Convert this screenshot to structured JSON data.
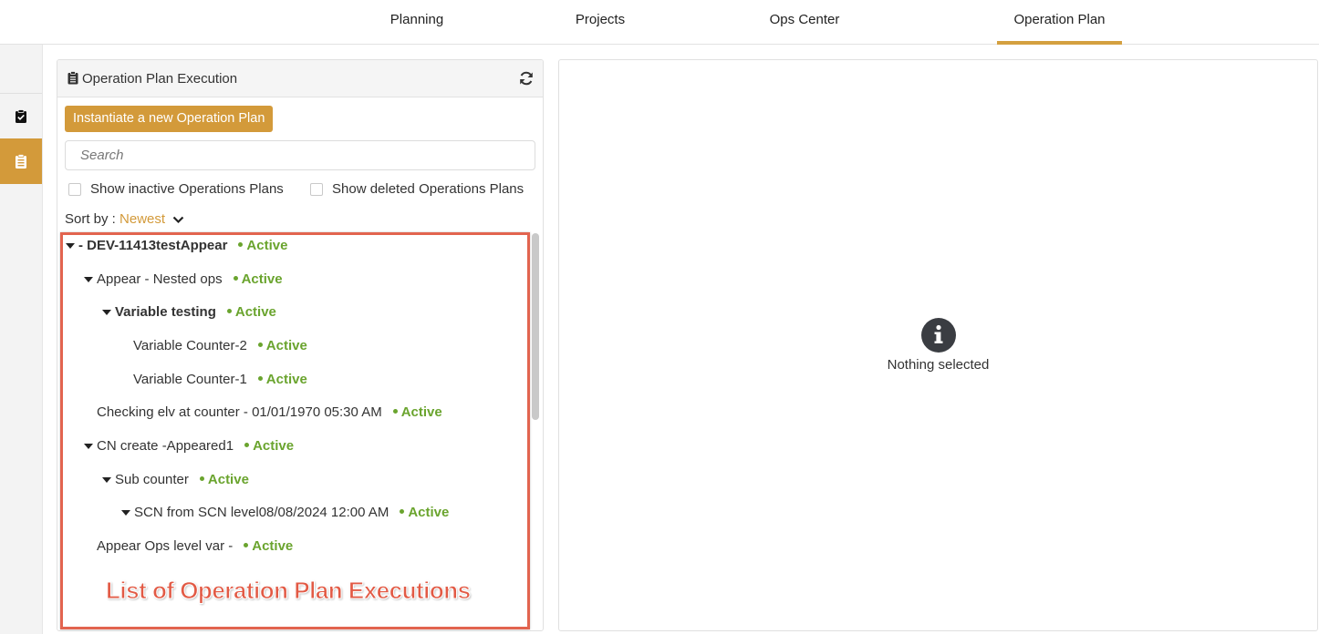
{
  "nav": {
    "tabs": [
      {
        "label": "Planning",
        "active": false
      },
      {
        "label": "Projects",
        "active": false
      },
      {
        "label": "Ops Center",
        "active": false
      },
      {
        "label": "Operation Plan",
        "active": true
      }
    ]
  },
  "rail": {
    "items": [
      {
        "icon": "clipboard-check-icon"
      },
      {
        "icon": "clipboard-list-icon",
        "active": true
      }
    ]
  },
  "panel": {
    "title": "Operation Plan Execution",
    "icon": "clipboard-icon",
    "refresh_icon": "refresh-icon",
    "new_button": "Instantiate a new Operation Plan",
    "search_placeholder": "Search",
    "show_inactive": "Show inactive Operations Plans",
    "show_deleted": "Show deleted Operations Plans",
    "sort_label": "Sort by :",
    "sort_value": "Newest"
  },
  "tree": [
    {
      "name": "- DEV-11413testAppear",
      "status": "Active",
      "expanded": true,
      "bold": true
    },
    {
      "name": "Appear - Nested ops",
      "status": "Active",
      "expanded": true,
      "bold": false
    },
    {
      "name": "Variable testing",
      "status": "Active",
      "expanded": true,
      "bold": true
    },
    {
      "name": "Variable Counter-2",
      "status": "Active",
      "expanded": false,
      "bold": false
    },
    {
      "name": "Variable Counter-1",
      "status": "Active",
      "expanded": false,
      "bold": false
    },
    {
      "name": "Checking elv at counter - 01/01/1970 05:30 AM",
      "status": "Active",
      "expanded": false,
      "bold": false
    },
    {
      "name": "CN create -Appeared1",
      "status": "Active",
      "expanded": true,
      "bold": false
    },
    {
      "name": "Sub counter",
      "status": "Active",
      "expanded": true,
      "bold": false
    },
    {
      "name": "SCN from SCN level08/08/2024 12:00 AM",
      "status": "Active",
      "expanded": true,
      "bold": false
    },
    {
      "name": "Appear Ops level var -",
      "status": "Active",
      "expanded": false,
      "bold": false
    }
  ],
  "annotation": {
    "label": "List of Operation Plan Executions",
    "color": "#e2644f"
  },
  "detail": {
    "empty_text": "Nothing selected",
    "icon": "info-icon"
  },
  "colors": {
    "accent": "#d39a3a",
    "active_status": "#6aa42e"
  }
}
